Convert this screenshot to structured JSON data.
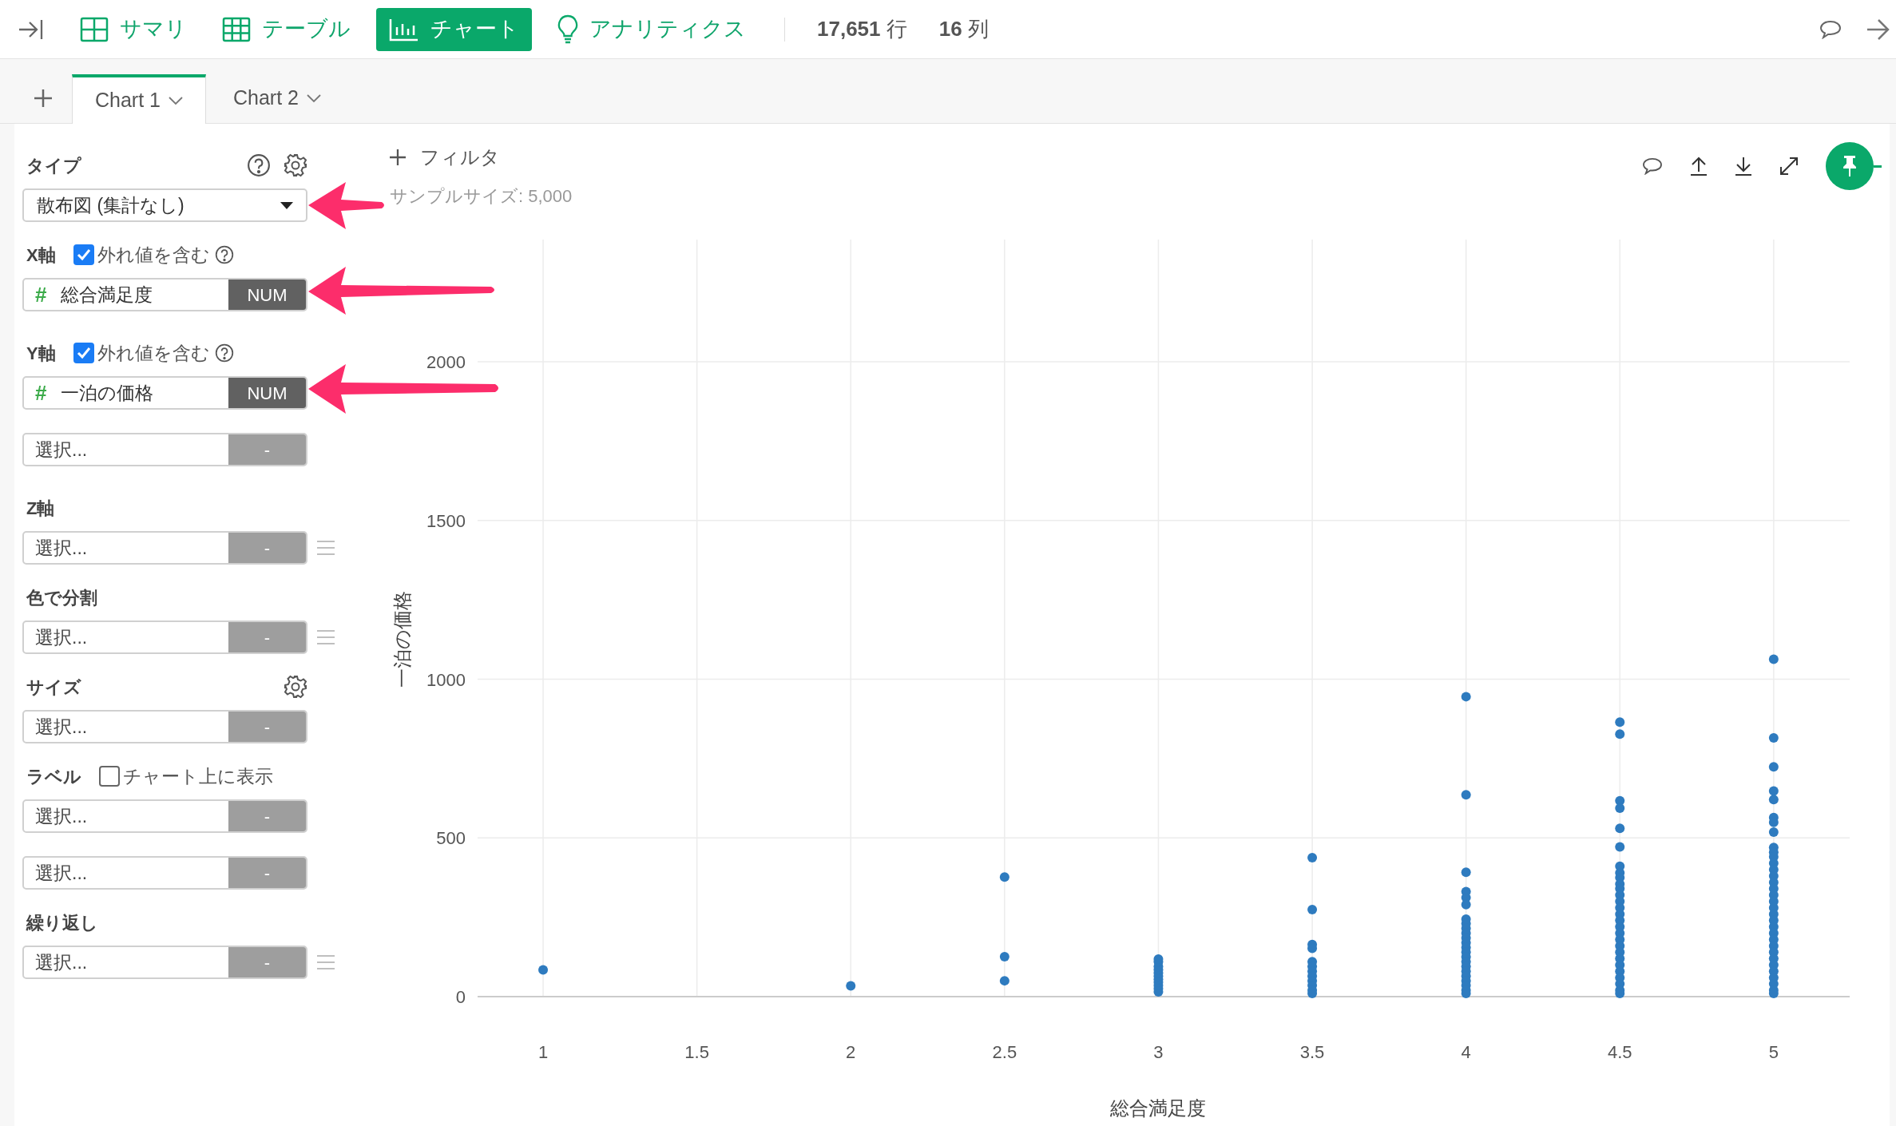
{
  "toolbar": {
    "nav": [
      {
        "kind": "summary",
        "label": "サマリ",
        "selected": false
      },
      {
        "kind": "table",
        "label": "テーブル",
        "selected": false
      },
      {
        "kind": "chart",
        "label": "チャート",
        "selected": true
      },
      {
        "kind": "analytics",
        "label": "アナリティクス",
        "selected": false
      }
    ],
    "stats": [
      "**17,651** 行",
      "**16** 列"
    ]
  },
  "chart_tabs": [
    {
      "label": "Chart 1",
      "selected": true
    },
    {
      "label": "Chart 2",
      "selected": false
    }
  ],
  "sidebar": {
    "sections": [
      {
        "kind": "type",
        "title": "タイプ",
        "fields": [
          {
            "kind": "dropdown",
            "value": "散布図 (集計なし)"
          }
        ]
      },
      {
        "kind": "axis",
        "title": "X軸",
        "checkbox": {
          "label": "外れ値を含む",
          "checked": true
        },
        "fields": [
          {
            "kind": "column",
            "symbol": "#",
            "value": "総合満足度",
            "badge": "NUM",
            "reorder": false
          }
        ]
      },
      {
        "kind": "axis",
        "title": "Y軸",
        "checkbox": {
          "label": "外れ値を含む",
          "checked": true
        },
        "fields": [
          {
            "kind": "column",
            "symbol": "#",
            "value": "一泊の価格",
            "badge": "NUM",
            "reorder": false
          },
          {
            "kind": "column",
            "placeholder": "選択...",
            "badge": "-",
            "reorder": false
          }
        ]
      },
      {
        "kind": "plain",
        "title": "Z軸",
        "fields": [
          {
            "kind": "column",
            "placeholder": "選択...",
            "badge": "-",
            "reorder": true
          }
        ]
      },
      {
        "kind": "plain",
        "title": "色で分割",
        "fields": [
          {
            "kind": "column",
            "placeholder": "選択...",
            "badge": "-",
            "reorder": true
          }
        ]
      },
      {
        "kind": "size",
        "title": "サイズ",
        "fields": [
          {
            "kind": "column",
            "placeholder": "選択...",
            "badge": "-",
            "reorder": false
          }
        ]
      },
      {
        "kind": "label",
        "title": "ラベル",
        "checkbox": {
          "label": "チャート上に表示",
          "checked": false
        },
        "fields": [
          {
            "kind": "column",
            "placeholder": "選択...",
            "badge": "-",
            "reorder": false
          },
          {
            "kind": "column",
            "placeholder": "選択...",
            "badge": "-",
            "reorder": false
          }
        ]
      },
      {
        "kind": "plain",
        "title": "繰り返し",
        "fields": [
          {
            "kind": "column",
            "placeholder": "選択...",
            "badge": "-",
            "reorder": true
          }
        ]
      }
    ]
  },
  "chart": {
    "filter": "フィルタ",
    "sample_size": "サンプルサイズ: 5,000",
    "chart_data": {
      "type": "scatter",
      "grid": true,
      "xlabel": "総合満足度",
      "ylabel": "一泊の価格",
      "xlim": [
        0.787,
        5.247
      ],
      "ylim": [
        0,
        2385
      ],
      "xticks": [
        1,
        1.5,
        2,
        2.5,
        3,
        3.5,
        4,
        4.5,
        5
      ],
      "yticks": [
        0,
        500,
        1000,
        1500,
        2000
      ],
      "x": [
        1,
        2,
        2.5,
        2.5,
        2.5,
        3,
        3,
        3,
        3,
        3,
        3,
        3,
        3,
        3,
        3,
        3,
        3.5,
        3.5,
        3.5,
        3.5,
        3.5,
        3.5,
        3.5,
        3.5,
        3.5,
        3.5,
        3.5,
        3.5,
        4,
        4,
        4,
        4,
        4,
        4,
        4,
        4,
        4,
        4,
        4,
        4,
        4,
        4,
        4,
        4,
        4,
        4,
        4,
        4,
        4,
        4,
        4,
        4.5,
        4.5,
        4.5,
        4.5,
        4.5,
        4.5,
        4.5,
        4.5,
        4.5,
        4.5,
        4.5,
        4.5,
        4.5,
        4.5,
        4.5,
        4.5,
        4.5,
        4.5,
        4.5,
        4.5,
        4.5,
        4.5,
        4.5,
        4.5,
        4.5,
        4.5,
        4.5,
        4.5,
        5,
        5,
        5,
        5,
        5,
        5,
        5,
        5,
        5,
        5,
        5,
        5,
        5,
        5,
        5,
        5,
        5,
        5,
        5,
        5,
        5,
        5,
        5,
        5,
        5,
        5,
        5,
        5,
        5,
        5,
        5,
        5,
        5
      ],
      "series": [
        {
          "color": "#2e7bbf",
          "values": [
            84,
            34,
            377,
            126,
            50,
            15,
            25,
            35,
            45,
            55,
            65,
            75,
            85,
            95,
            110,
            118,
            438,
            274,
            164,
            152,
            110,
            95,
            80,
            65,
            50,
            35,
            20,
            10,
            945,
            636,
            392,
            331,
            312,
            290,
            244,
            230,
            215,
            200,
            185,
            170,
            155,
            140,
            125,
            110,
            95,
            80,
            65,
            50,
            35,
            20,
            10,
            865,
            827,
            617,
            594,
            530,
            472,
            411,
            390,
            375,
            355,
            340,
            320,
            300,
            280,
            260,
            240,
            220,
            200,
            180,
            160,
            140,
            120,
            100,
            80,
            60,
            40,
            20,
            10,
            1063,
            815,
            724,
            648,
            621,
            564,
            549,
            518,
            470,
            455,
            440,
            420,
            400,
            380,
            360,
            340,
            320,
            300,
            280,
            260,
            240,
            220,
            200,
            180,
            160,
            140,
            120,
            100,
            80,
            60,
            40,
            20,
            10
          ]
        }
      ]
    }
  }
}
